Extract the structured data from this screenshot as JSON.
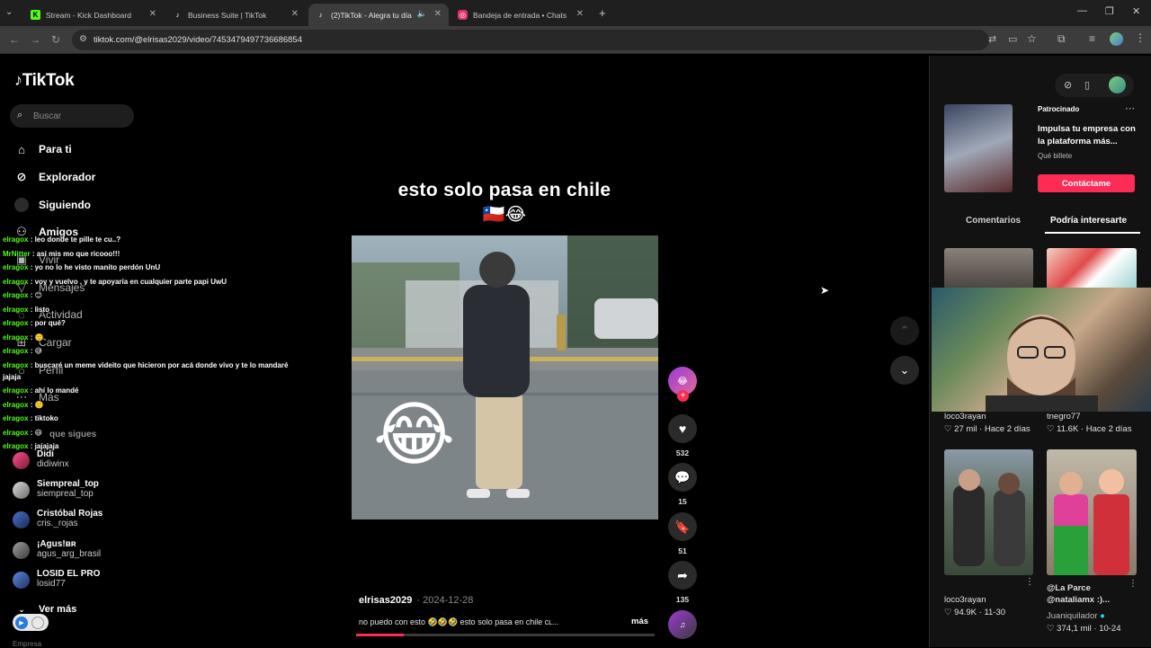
{
  "browser": {
    "tabs": [
      {
        "label": "Stream - Kick Dashboard",
        "favicon": "kick-icon",
        "color": "#53fc18"
      },
      {
        "label": "Business Suite | TikTok",
        "favicon": "tiktok-icon",
        "color": "#ffffff"
      },
      {
        "label": "(2)TikTok - Alegra tu día",
        "favicon": "tiktok-icon",
        "color": "#ffffff"
      },
      {
        "label": "Bandeja de entrada • Chats",
        "favicon": "instagram-icon",
        "color": "#e1306c"
      }
    ],
    "url": "tiktok.com/@elrisas2029/video/7453479497736686854"
  },
  "tiktok": {
    "logo": "TikTok",
    "search_placeholder": "Buscar",
    "nav": [
      {
        "label": "Para ti",
        "icon": "home-icon"
      },
      {
        "label": "Explorador",
        "icon": "compass-icon"
      },
      {
        "label": "Siguiendo",
        "icon": "following-icon"
      },
      {
        "label": "Amigos",
        "icon": "friends-icon"
      },
      {
        "label": "Vivir",
        "icon": "live-icon"
      },
      {
        "label": "Mensajes",
        "icon": "messages-icon"
      },
      {
        "label": "Actividad",
        "icon": "activity-icon"
      },
      {
        "label": "Cargar",
        "icon": "upload-icon"
      },
      {
        "label": "Perfil",
        "icon": "profile-icon"
      },
      {
        "label": "Más",
        "icon": "more-icon"
      }
    ],
    "following_header": "que sigues",
    "accounts": [
      {
        "name": "Didi",
        "handle": "didiwinx"
      },
      {
        "name": "Siempreal_top",
        "handle": "siempreal_top"
      },
      {
        "name": "Cristóbal Rojas",
        "handle": "cris._rojas"
      },
      {
        "name": "¡Agus!ʙʀ",
        "handle": "agus_arg_brasil"
      },
      {
        "name": "LOSID EL PRO",
        "handle": "losid77"
      }
    ],
    "see_more": "Ver más",
    "footer": "Empresa"
  },
  "chat": [
    {
      "user": "elragox",
      "msg": "leo donde te pille te cu..?"
    },
    {
      "user": "MrNitter",
      "msg": "así mis mo que ricooo!!!"
    },
    {
      "user": "elragox",
      "msg": "yo no lo he visto manito perdón UnU"
    },
    {
      "user": "elragox",
      "msg": "voy y vuelvo , y te apoyaría en cualquier parte papi UwU"
    },
    {
      "user": "elragox",
      "msg": "😊"
    },
    {
      "user": "elragox",
      "msg": "listo"
    },
    {
      "user": "elragox",
      "msg": "por qué?"
    },
    {
      "user": "elragox",
      "msg": "🙂"
    },
    {
      "user": "elragox",
      "msg": "😅"
    },
    {
      "user": "elragox",
      "msg": "buscaré un meme videito que hicieron por acá donde vivo y te lo mandaré"
    },
    {
      "user": "",
      "msg": "jajaja"
    },
    {
      "user": "elragox",
      "msg": "ahí lo mandé"
    },
    {
      "user": "elragox",
      "msg": "🙂"
    },
    {
      "user": "elragox",
      "msg": "tiktoko"
    },
    {
      "user": "elragox",
      "msg": "😄"
    },
    {
      "user": "elragox",
      "msg": "jajajaja"
    }
  ],
  "video": {
    "caption_text": "esto solo pasa en chile",
    "caption_emoji": "🇨🇱😂",
    "author": "elrisas2029",
    "date": "· 2024-12-28",
    "description": "no puedo con esto 🤣🤣🤣 esto solo pasa en chile ᴄʟ...",
    "more": "más",
    "progress": 0.16,
    "likes": "532",
    "comments": "15",
    "saves": "51",
    "shares": "135",
    "laugh_emoji": "😂"
  },
  "right_panel": {
    "sponsored": "Patrocinado",
    "ad_title": "Impulsa tu empresa con la plataforma más...",
    "ad_sub": "Qué billete",
    "ad_button": "Contáctame",
    "tabs": [
      "Comentarios",
      "Podría interesarte"
    ],
    "videos": [
      {
        "user": "loco3rayan",
        "likes": "27 mil",
        "age": "Hace 2 días"
      },
      {
        "user": "tnegro77",
        "likes": "11.6K",
        "age": "Hace 2 días"
      },
      {
        "user": "loco3rayan",
        "likes": "94.9K",
        "age": "11-30",
        "title": ""
      },
      {
        "user": "Juaniquilador",
        "likes": "374,1 mil",
        "age": "10-24",
        "title": "@La Parce @nataliamx :)..."
      }
    ]
  }
}
